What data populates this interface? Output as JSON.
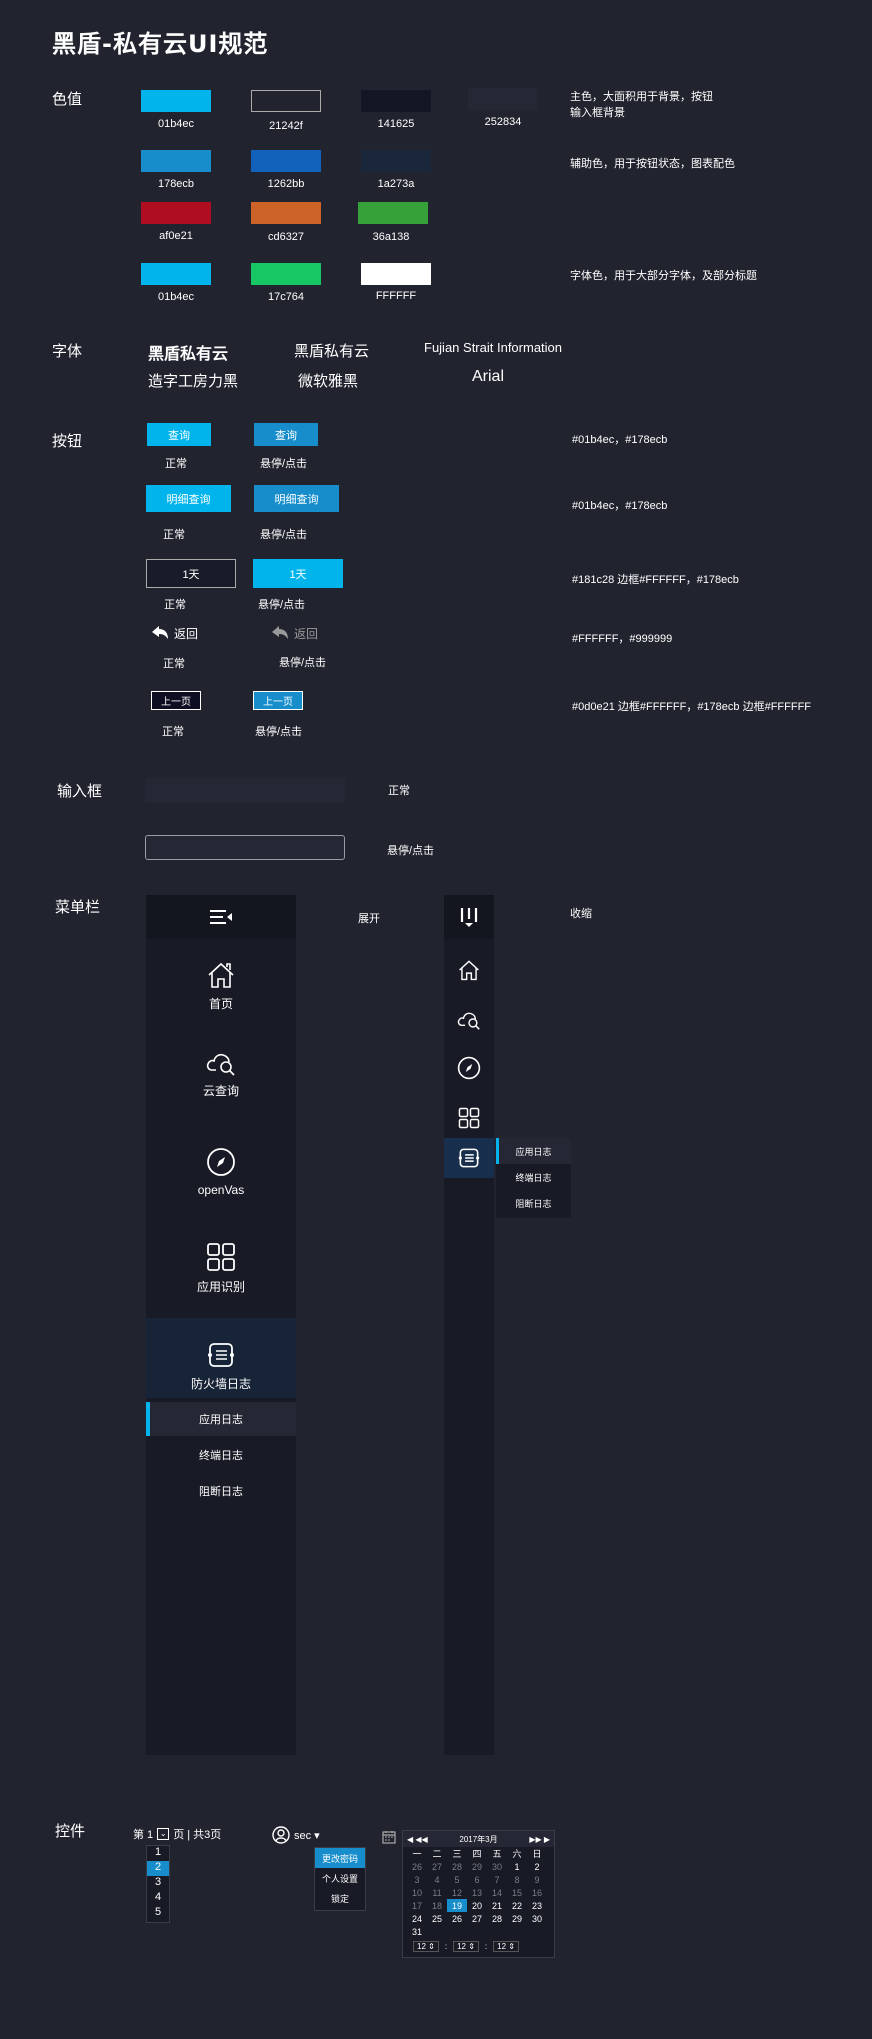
{
  "page_title": "黑盾-私有云UI规范",
  "colors": {
    "section_label": "色值",
    "row1": [
      {
        "hex": "#01b4ec",
        "label": "01b4ec"
      },
      {
        "hex": "#21242f",
        "label": "21242f",
        "outlined": true
      },
      {
        "hex": "#141625",
        "label": "141625"
      },
      {
        "hex": "#252834",
        "label": "252834"
      }
    ],
    "row1_note_line1": "主色，大面积用于背景，按钮",
    "row1_note_line2": "输入框背景",
    "row2": [
      {
        "hex": "#178ecb",
        "label": "178ecb"
      },
      {
        "hex": "#1262bb",
        "label": "1262bb"
      },
      {
        "hex": "#1a273a",
        "label": "1a273a"
      }
    ],
    "row2_note": "辅助色，用于按钮状态，图表配色",
    "row3": [
      {
        "hex": "#af0e21",
        "label": "af0e21"
      },
      {
        "hex": "#cd6327",
        "label": "cd6327"
      },
      {
        "hex": "#36a138",
        "label": "36a138"
      }
    ],
    "row4": [
      {
        "hex": "#01b4ec",
        "label": "01b4ec"
      },
      {
        "hex": "#17c764",
        "label": "17c764"
      },
      {
        "hex": "#ffffff",
        "label": "FFFFFF"
      }
    ],
    "row4_note": "字体色，用于大部分字体，及部分标题"
  },
  "fonts": {
    "section_label": "字体",
    "sample1_top": "黑盾私有云",
    "sample1_bottom": "造字工房力黑",
    "sample2_top": "黑盾私有云",
    "sample2_bottom": "微软雅黑",
    "sample3_top": "Fujian Strait Information",
    "sample3_bottom": "Arial"
  },
  "buttons": {
    "section_label": "按钮",
    "normal": "正常",
    "hover": "悬停/点击",
    "query": "查询",
    "detail_query": "明细查询",
    "one_day": "1天",
    "back": "返回",
    "prev_page": "上一页",
    "note1": "#01b4ec，#178ecb",
    "note2": "#01b4ec，#178ecb",
    "note3": "#181c28  边框#FFFFFF，#178ecb",
    "note4": "#FFFFFF，#999999",
    "note5": "#0d0e21  边框#FFFFFF，#178ecb  边框#FFFFFF"
  },
  "inputs": {
    "section_label": "输入框",
    "normal": "正常",
    "hover": "悬停/点击"
  },
  "menu": {
    "section_label": "菜单栏",
    "expanded_label": "展开",
    "collapsed_label": "收缩",
    "items": [
      "首页",
      "云查询",
      "openVas",
      "应用识别",
      "防火墙日志"
    ],
    "sub_items": [
      "应用日志",
      "终端日志",
      "阻断日志"
    ],
    "flyout_items": [
      "应用日志",
      "终端日志",
      "阻断日志"
    ]
  },
  "controls": {
    "section_label": "控件",
    "pager_prefix": "第 1",
    "pager_suffix": "页  | 共3页",
    "pager_options": [
      "1",
      "2",
      "3",
      "4",
      "5"
    ],
    "user_name": "sec ▾",
    "user_menu": [
      "更改密码",
      "个人设置",
      "锁定"
    ],
    "calendar": {
      "month": "2017年3月",
      "weekdays": [
        "一",
        "二",
        "三",
        "四",
        "五",
        "六",
        "日"
      ],
      "weeks": [
        [
          "26",
          "27",
          "28",
          "29",
          "30",
          "1",
          "2"
        ],
        [
          "3",
          "4",
          "5",
          "6",
          "7",
          "8",
          "9"
        ],
        [
          "10",
          "11",
          "12",
          "13",
          "14",
          "15",
          "16"
        ],
        [
          "17",
          "18",
          "19",
          "20",
          "21",
          "22",
          "23"
        ],
        [
          "24",
          "25",
          "26",
          "27",
          "28",
          "29",
          "30"
        ],
        [
          "31",
          "",
          "",
          "",
          "",
          "",
          ""
        ]
      ],
      "selected_day": "19",
      "time_values": [
        "12",
        "12",
        "12"
      ]
    }
  }
}
